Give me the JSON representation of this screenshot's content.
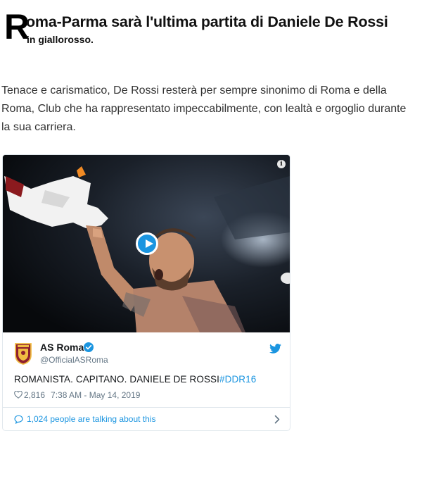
{
  "article": {
    "dropcap": "R",
    "title_line1": "oma-Parma sarà l'ultima partita di Daniele De Rossi",
    "title_line2": "in giallorosso.",
    "intro": "Tenace e carismatico, De Rossi resterà per sempre sinonimo di Roma e della Roma, Club che ha rappresentato impeccabilmente, con lealtà e orgoglio durante la sua carriera."
  },
  "tweet": {
    "media": {
      "info_icon": "info-icon",
      "play_icon": "play-icon"
    },
    "account_name": "AS Roma",
    "handle": "@OfficialASRoma",
    "text": "ROMANISTA. CAPITANO. DANIELE DE ROSSI",
    "hashtag": "#DDR16",
    "likes": "2,816",
    "timestamp": "7:38 AM - May 14, 2019",
    "footer": "1,024 people are talking about this",
    "colors": {
      "accent": "#1b95e0",
      "muted": "#657786",
      "text": "#14171a",
      "border": "#e1e8ed"
    }
  }
}
